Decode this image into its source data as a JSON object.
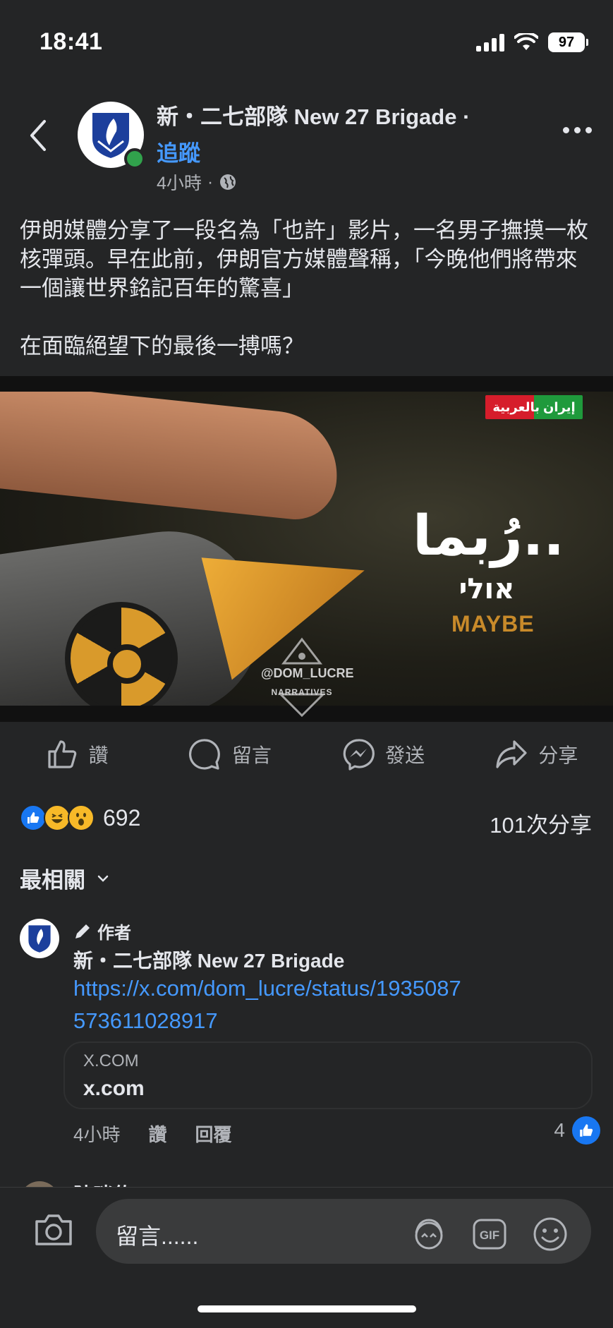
{
  "status_bar": {
    "time": "18:41",
    "battery": "97"
  },
  "post": {
    "page_name": "新・二七部隊 New 27 Brigade ·",
    "follow_label": "追蹤",
    "time_ago": "4小時",
    "separator": "·",
    "text": "伊朗媒體分享了一段名為「也許」影片，一名男子撫摸一枚核彈頭。早在此前，伊朗官方媒體聲稱，「今晚他們將帶來一個讓世界銘記百年的驚喜」\n\n在面臨絕望下的最後一搏嗎？",
    "media": {
      "brand_badge": "إيران بالعربية",
      "title_ar": "رُبما..",
      "title_he": "אולי",
      "title_en": "MAYBE",
      "watermark": "@DOM_LUCRE",
      "watermark_sub": "NARRATIVES"
    }
  },
  "actions": {
    "like": "讚",
    "comment": "留言",
    "send": "發送",
    "share": "分享"
  },
  "reactions": {
    "count": "692",
    "shares": "101次分享"
  },
  "sort": {
    "label": "最相關"
  },
  "comment": {
    "author_badge": "作者",
    "name": "新・二七部隊 New 27 Brigade",
    "link": "https://x.com/dom_lucre/status/1935087573611028917",
    "card_domain": "X.COM",
    "card_title": "x.com",
    "time_ago": "4小時",
    "like_label": "讚",
    "reply_label": "回覆",
    "like_count": "4"
  },
  "next_comment": {
    "name": "陳咪佑"
  },
  "composer": {
    "placeholder": "留言......"
  },
  "colors": {
    "background": "#242526",
    "link_blue": "#4599ff",
    "like_blue": "#1877f2",
    "online_green": "#31a24c"
  }
}
